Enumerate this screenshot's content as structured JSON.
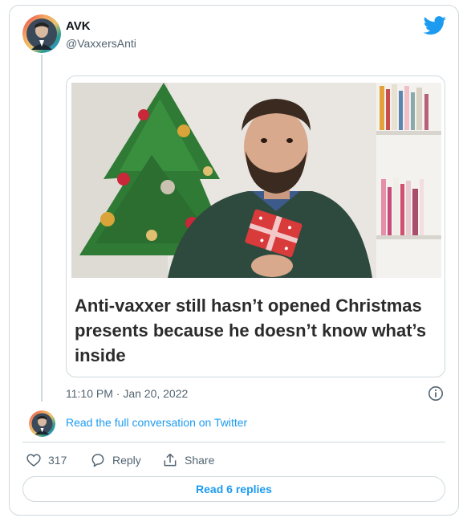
{
  "tweet": {
    "author": {
      "display_name": "AVK",
      "handle": "@VaxxersAnti",
      "avatar_icon": "avatar-icon"
    },
    "brand_icon": "twitter-bird-icon",
    "embedded_card": {
      "headline": "Anti-vaxxer still hasn’t opened Christmas presents because he doesn’t know what’s inside",
      "image_icon": "christmas-photo"
    },
    "timestamp": "11:10 PM · Jan 20, 2022",
    "info_icon": "info-icon",
    "read_conversation": "Read the full conversation on Twitter",
    "actions": {
      "like_count": "317",
      "reply_label": "Reply",
      "share_label": "Share"
    },
    "read_replies_label": "Read 6 replies"
  },
  "colors": {
    "accent": "#1d9bf0",
    "text_primary": "#0f1419",
    "text_secondary": "#536471",
    "border": "#cfd9de"
  }
}
